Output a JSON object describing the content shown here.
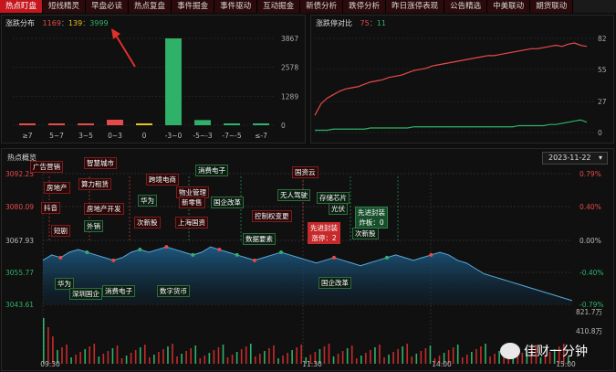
{
  "tabs": [
    {
      "label": "热点盯盘",
      "active": true
    },
    {
      "label": "短线精灵",
      "active": false
    },
    {
      "label": "早盘必读",
      "active": false
    },
    {
      "label": "热点复盘",
      "active": false
    },
    {
      "label": "事件掘金",
      "active": false
    },
    {
      "label": "事件驱动",
      "active": false
    },
    {
      "label": "互动掘金",
      "active": false
    },
    {
      "label": "新债分析",
      "active": false
    },
    {
      "label": "跌停分析",
      "active": false
    },
    {
      "label": "昨日涨停表现",
      "active": false
    },
    {
      "label": "公告精选",
      "active": false
    },
    {
      "label": "中美联动",
      "active": false
    },
    {
      "label": "期货联动",
      "active": false
    }
  ],
  "distribution": {
    "title": "涨跌分布",
    "up": "1169",
    "flat": "139",
    "down": "3999",
    "colors": {
      "up": "#e84a4a",
      "flat": "#e8c41a",
      "down": "#2fb16a"
    },
    "chart_data": {
      "type": "bar",
      "categories": [
        "≥7",
        "5~7",
        "3~5",
        "0~3",
        "0",
        "-3~0",
        "-5~-3",
        "-7~-5",
        "≤-7"
      ],
      "values": [
        70,
        18,
        25,
        245,
        35,
        3867,
        230,
        35,
        40
      ],
      "colors": [
        "#e84a4a",
        "#e84a4a",
        "#e84a4a",
        "#e84a4a",
        "#e8c41a",
        "#2fb16a",
        "#2fb16a",
        "#2fb16a",
        "#2fb16a"
      ],
      "ylim": [
        0,
        3867
      ],
      "yticks": [
        "3867",
        "2578",
        "1289",
        "0"
      ]
    }
  },
  "limit": {
    "title": "涨跌停对比",
    "up": "75",
    "down": "11",
    "yticks": [
      "82",
      "55",
      "27",
      "0"
    ],
    "chart_data": {
      "type": "line",
      "ylim": [
        0,
        82
      ],
      "series": [
        {
          "color": "#e84a4a",
          "values": [
            15,
            25,
            30,
            33,
            36,
            38,
            39,
            40,
            42,
            44,
            45,
            46,
            48,
            49,
            50,
            52,
            54,
            55,
            56,
            58,
            59,
            60,
            61,
            62,
            63,
            64,
            65,
            66,
            67,
            67,
            68,
            69,
            70,
            71,
            72,
            73,
            73,
            74,
            75,
            76,
            75,
            77,
            78,
            76,
            75
          ]
        },
        {
          "color": "#2fb16a",
          "values": [
            2,
            2,
            2,
            3,
            3,
            3,
            3,
            3,
            3,
            4,
            4,
            4,
            4,
            4,
            4,
            4,
            5,
            5,
            5,
            5,
            5,
            5,
            5,
            5,
            5,
            5,
            5,
            5,
            5,
            5,
            5,
            5,
            5,
            6,
            6,
            6,
            6,
            6,
            7,
            7,
            8,
            9,
            10,
            11,
            9
          ]
        }
      ]
    }
  },
  "hot": {
    "title": "热点概览",
    "date": "2023-11-22",
    "yleft": [
      "3092.25",
      "3080.09",
      "3067.93",
      "3055.77",
      "3043.61"
    ],
    "yright": [
      "0.79%",
      "0.40%",
      "0.00%",
      "-0.40%",
      "-0.79%"
    ],
    "vol": [
      "821.7万",
      "410.8万"
    ],
    "xticks": [
      "09:30",
      "11:30",
      "14:00",
      "15:00"
    ],
    "chart_data": {
      "type": "line",
      "ylim": [
        3043.61,
        3092.25
      ],
      "values": [
        3060,
        3062,
        3061,
        3063,
        3064,
        3063,
        3062,
        3061,
        3060,
        3061,
        3063,
        3064,
        3063,
        3064,
        3065,
        3064,
        3063,
        3062,
        3063,
        3065,
        3064,
        3063,
        3062,
        3061,
        3060,
        3061,
        3062,
        3063,
        3062,
        3061,
        3060,
        3059,
        3060,
        3061,
        3060,
        3059,
        3058,
        3059,
        3060,
        3061,
        3062,
        3061,
        3060,
        3061,
        3062,
        3063,
        3062,
        3060,
        3059,
        3057,
        3055,
        3054,
        3053,
        3052,
        3051,
        3050,
        3049,
        3048,
        3047,
        3046,
        3045
      ]
    },
    "tags": [
      {
        "t": "广告营销",
        "c": "red"
      },
      {
        "t": "智慧城市",
        "c": "red"
      },
      {
        "t": "房地产",
        "c": "red"
      },
      {
        "t": "算力租赁",
        "c": "red"
      },
      {
        "t": "抖音",
        "c": "red"
      },
      {
        "t": "房地产开发",
        "c": "red"
      },
      {
        "t": "短剧",
        "c": "red"
      },
      {
        "t": "外销",
        "c": "green"
      },
      {
        "t": "跨境电商",
        "c": "red"
      },
      {
        "t": "消费电子",
        "c": "green"
      },
      {
        "t": "物业管理",
        "c": "red"
      },
      {
        "t": "华为",
        "c": "green"
      },
      {
        "t": "新零售",
        "c": "red"
      },
      {
        "t": "国企改革",
        "c": "green"
      },
      {
        "t": "次新股",
        "c": "red"
      },
      {
        "t": "上海国资",
        "c": "red"
      },
      {
        "t": "控制权变更",
        "c": "red"
      },
      {
        "t": "数据要素",
        "c": "green"
      },
      {
        "t": "国资云",
        "c": "red"
      },
      {
        "t": "无人驾驶",
        "c": "green"
      },
      {
        "t": "存储芯片",
        "c": "green"
      },
      {
        "t": "光伏",
        "c": "green"
      },
      {
        "t": "次新股",
        "c": "green"
      },
      {
        "t": "华为",
        "c": "green"
      },
      {
        "t": "深圳国企",
        "c": "green"
      },
      {
        "t": "消费电子",
        "c": "green"
      },
      {
        "t": "数字货币",
        "c": "green"
      },
      {
        "t": "国企改革",
        "c": "green"
      }
    ],
    "seal_up": {
      "line1": "先进封装",
      "line2": "涨停：2"
    },
    "seal_down": {
      "line1": "先进封装",
      "line2": "炸板：0"
    }
  },
  "watermark": "佳财一分钟"
}
